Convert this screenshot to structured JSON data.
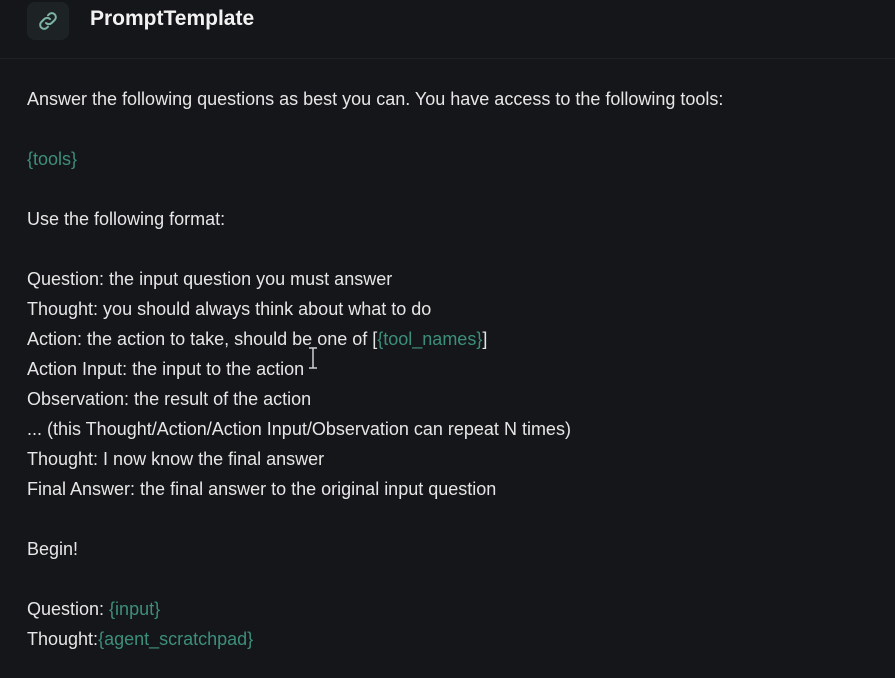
{
  "header": {
    "title": "PromptTemplate",
    "icon": "link-icon"
  },
  "template": {
    "intro": "Answer the following questions as best you can. You have access to the following tools:",
    "tools_var": "{tools}",
    "format_intro": "Use the following format:",
    "question_line": "Question: the input question you must answer",
    "thought_line": "Thought: you should always think about what to do",
    "action_prefix": "Action: the action to take, should be one of [",
    "tool_names_var": "{tool_names}",
    "action_suffix": "]",
    "action_input_line": "Action Input: the input to the action",
    "observation_line": "Observation: the result of the action",
    "repeat_line": "... (this Thought/Action/Action Input/Observation can repeat N times)",
    "final_thought_line": "Thought: I now know the final answer",
    "final_answer_line": "Final Answer: the final answer to the original input question",
    "begin_line": "Begin!",
    "question_label": "Question: ",
    "input_var": "{input}",
    "thought_label": "Thought:",
    "scratchpad_var": "{agent_scratchpad}"
  },
  "colors": {
    "background": "#151619",
    "text": "#e6e6e6",
    "variable": "#3c8f7c"
  }
}
